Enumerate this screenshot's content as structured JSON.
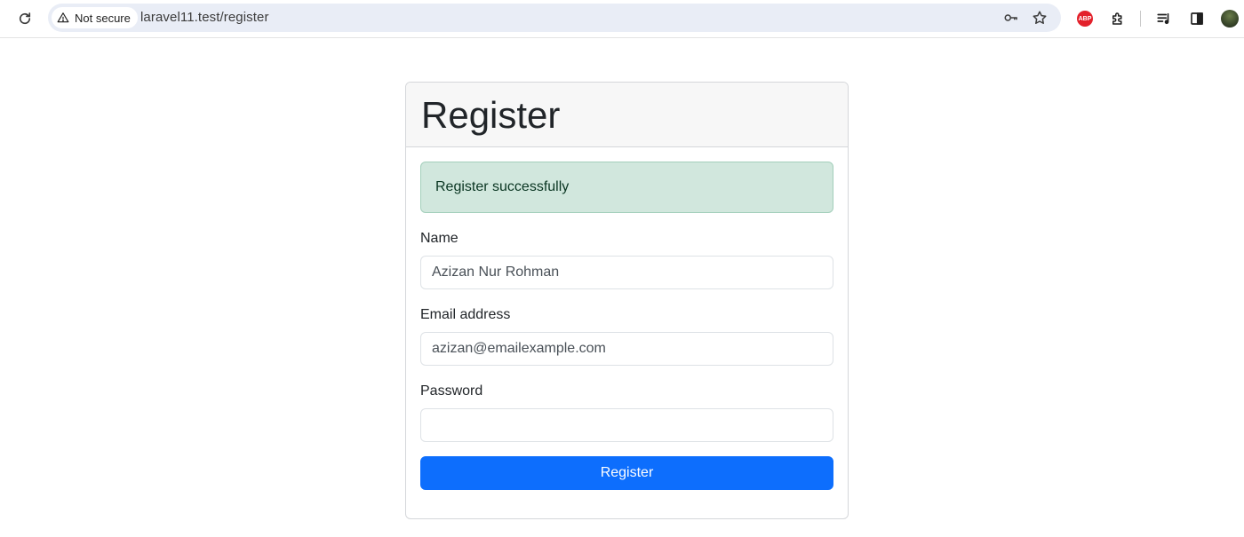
{
  "browser": {
    "security_label": "Not secure",
    "url": "laravel11.test/register",
    "icons": [
      "reload-icon",
      "warning-icon",
      "key-icon",
      "star-icon",
      "adblock-icon",
      "extensions-icon",
      "media-queue-icon",
      "side-panel-icon",
      "profile-avatar"
    ],
    "adblock_text": "ABP"
  },
  "card": {
    "title": "Register",
    "alert_text": "Register successfully",
    "fields": {
      "name": {
        "label": "Name",
        "value": "Azizan Nur Rohman",
        "placeholder": ""
      },
      "email": {
        "label": "Email address",
        "value": "azizan@emailexample.com",
        "placeholder": ""
      },
      "password": {
        "label": "Password",
        "value": "",
        "placeholder": ""
      }
    },
    "submit_label": "Register"
  },
  "colors": {
    "primary": "#0d6efd",
    "alert_bg": "#d1e7dd",
    "alert_text": "#0a3622",
    "header_bg": "#f7f7f7"
  }
}
